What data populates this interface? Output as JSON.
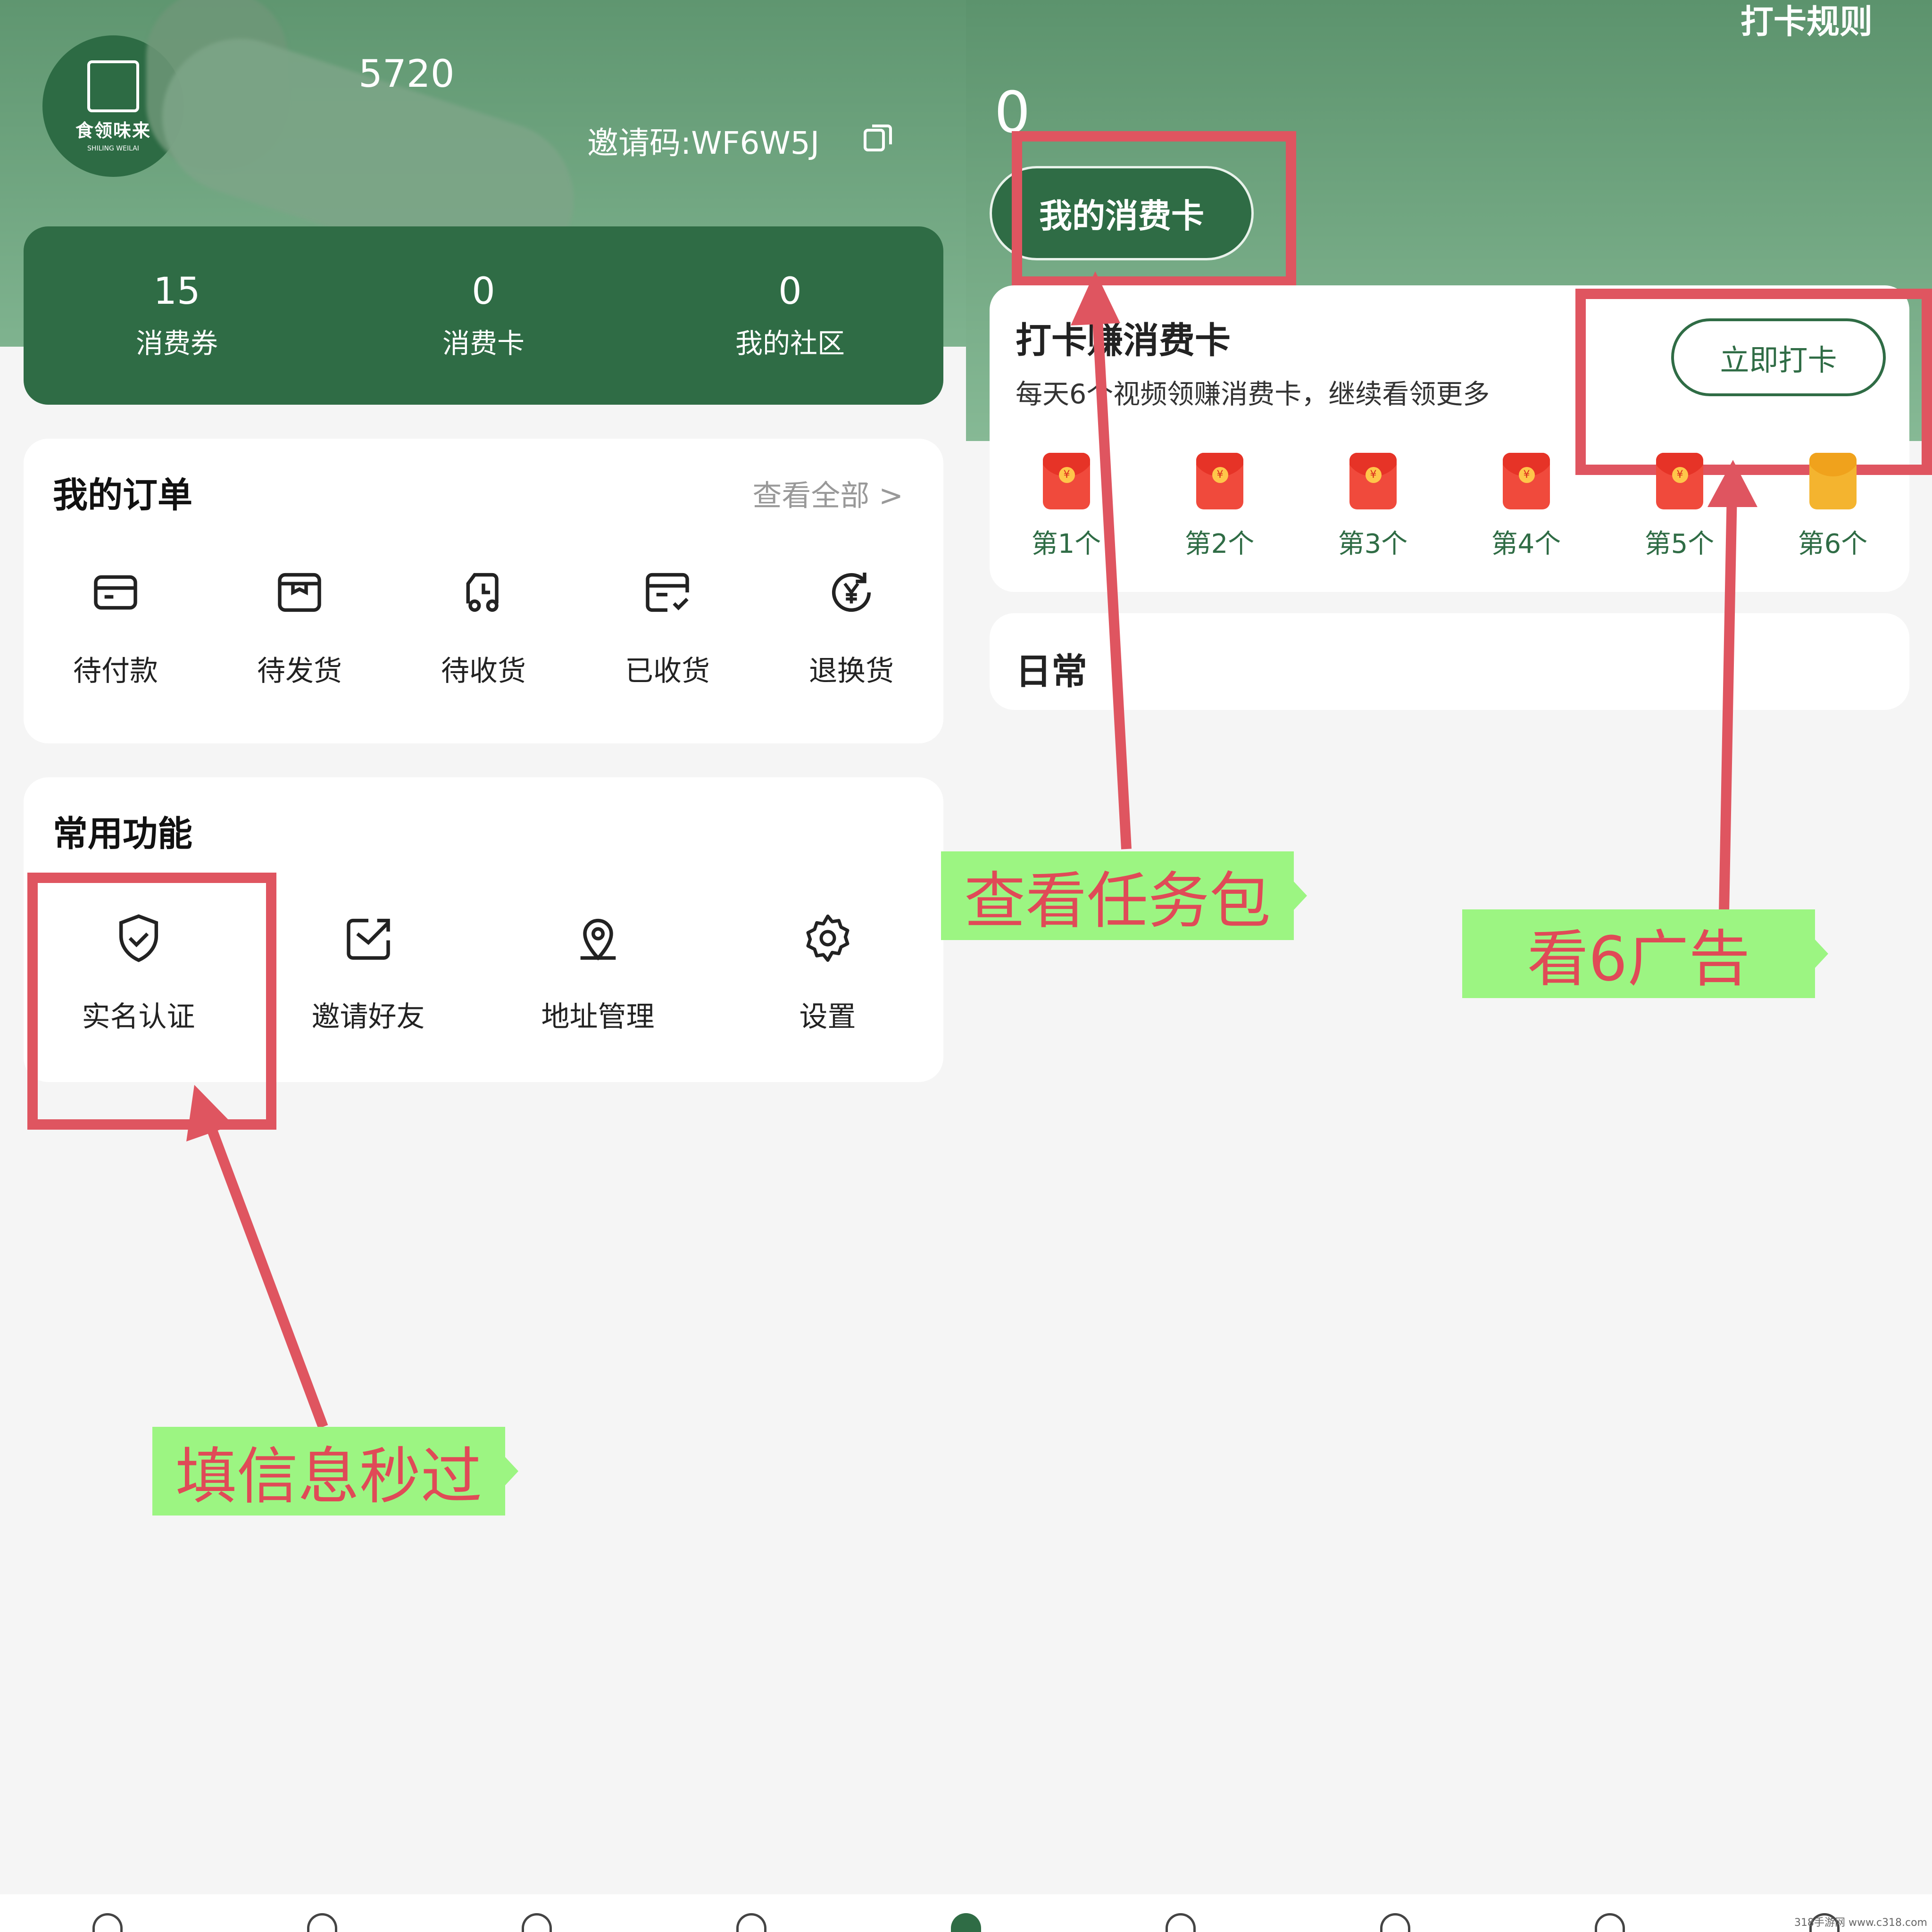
{
  "profile": {
    "logo_text": "食领味来",
    "logo_en": "SHILING WEILAI",
    "user_id_partial": "5720",
    "invite_code": "邀请码:WF6W5J"
  },
  "stats": [
    {
      "value": "15",
      "label": "消费券"
    },
    {
      "value": "0",
      "label": "消费卡"
    },
    {
      "value": "0",
      "label": "我的社区"
    }
  ],
  "orders": {
    "title": "我的订单",
    "view_all": "查看全部 >",
    "items": [
      {
        "label": "待付款",
        "icon": "wallet-icon"
      },
      {
        "label": "待发货",
        "icon": "box-icon"
      },
      {
        "label": "待收货",
        "icon": "truck-icon"
      },
      {
        "label": "已收货",
        "icon": "received-icon"
      },
      {
        "label": "退换货",
        "icon": "refund-icon"
      }
    ]
  },
  "functions": {
    "title": "常用功能",
    "items": [
      {
        "label": "实名认证",
        "icon": "shield-check-icon"
      },
      {
        "label": "邀请好友",
        "icon": "invite-icon"
      },
      {
        "label": "地址管理",
        "icon": "location-icon"
      },
      {
        "label": "设置",
        "icon": "gear-icon"
      }
    ]
  },
  "right": {
    "rules": "打卡规则",
    "balance": "0",
    "my_card_button": "我的消费卡",
    "checkin_title": "打卡赚消费卡",
    "checkin_sub": "每天6个视频领赚消费卡，继续看领更多",
    "checkin_button": "立即打卡",
    "rewards": [
      "第1个",
      "第2个",
      "第3个",
      "第4个",
      "第5个",
      "第6个"
    ],
    "daily_title": "日常"
  },
  "annotations": {
    "task": "查看任务包",
    "ads": "看6广告",
    "verify": "填信息秒过"
  },
  "colors": {
    "brand_green": "#2f6c45",
    "annotation_red": "#df5560",
    "callout_green": "#9cf582"
  },
  "watermark": "318手游网 www.c318.com"
}
